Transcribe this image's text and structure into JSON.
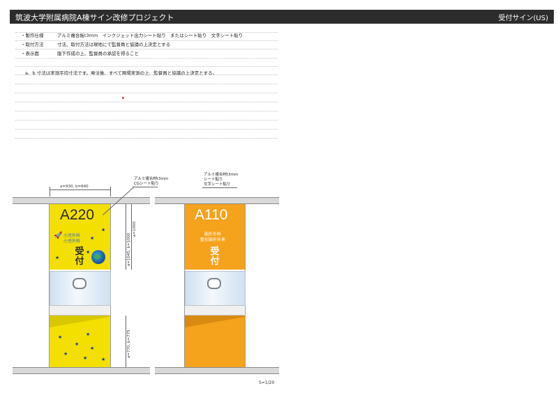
{
  "header": {
    "title": "筑波大学附属病院A棟サイン改修プロジェクト",
    "subtitle": "受付サイン(US)"
  },
  "specs": [
    {
      "label": "・製作仕様",
      "value": "アルミ複合板t3mm　インクジェット出力シート貼り　またはシート貼り　文字シート貼り"
    },
    {
      "label": "・取付方法",
      "value": "寸法、取付方法は現地にて監督員と協議の上決定とする"
    },
    {
      "label": "・表示面",
      "value": "版下作成の上、監督員の承認を得ること"
    }
  ],
  "note": "a、b 寸法は実測平均寸法です。発注後、すべて現場実測の上、監督員と協議の上決定とする。",
  "sign_left": {
    "room": "A220",
    "dept_line1": "小児外科",
    "dept_line2": "小児外科",
    "reception": "受付",
    "color": "#f3e000",
    "callout_line1": "アルミ複合材t3mm",
    "callout_line2": "CGシート貼り",
    "dim_top": "a=930, b=640",
    "dim_upper_a": "a=1045, b=1000",
    "dim_upper_b": "a=1000",
    "dim_lower": "a=770, b=775"
  },
  "sign_right": {
    "room": "A110",
    "dept_line1": "脳外外科",
    "dept_line2": "整形脳外外来",
    "reception": "受付",
    "color": "#f5a21c",
    "callout_line1": "アルミ複合材t3mm",
    "callout_line2": "シート貼り",
    "callout_line3": "文字シート貼り"
  },
  "page_number": "S=1/20"
}
